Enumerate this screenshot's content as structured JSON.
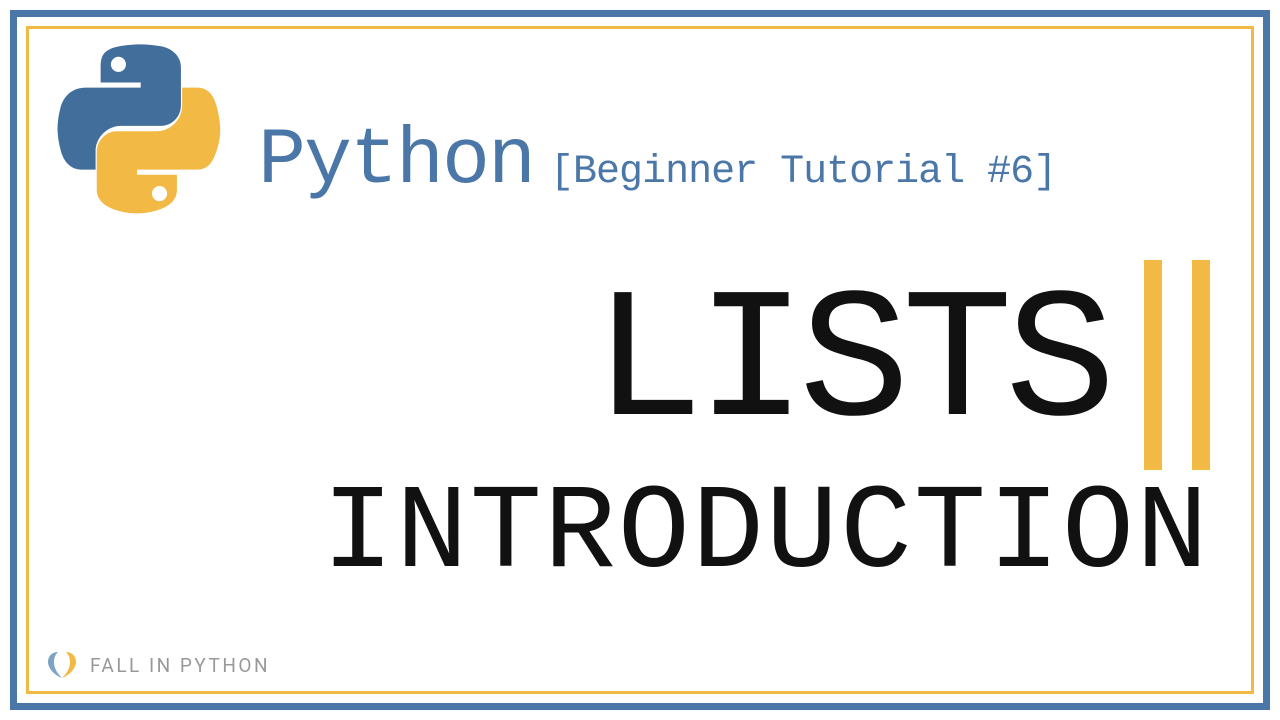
{
  "header": {
    "title": "Python",
    "subtitle": "[Beginner Tutorial #6]"
  },
  "main": {
    "topic": "LISTS",
    "subtopic": "INTRODUCTION"
  },
  "brand": {
    "name": "FALL IN PYTHON"
  },
  "colors": {
    "blue": "#4a77a8",
    "yellow": "#f2ba45",
    "text_dark": "#111",
    "text_gray": "#999"
  }
}
